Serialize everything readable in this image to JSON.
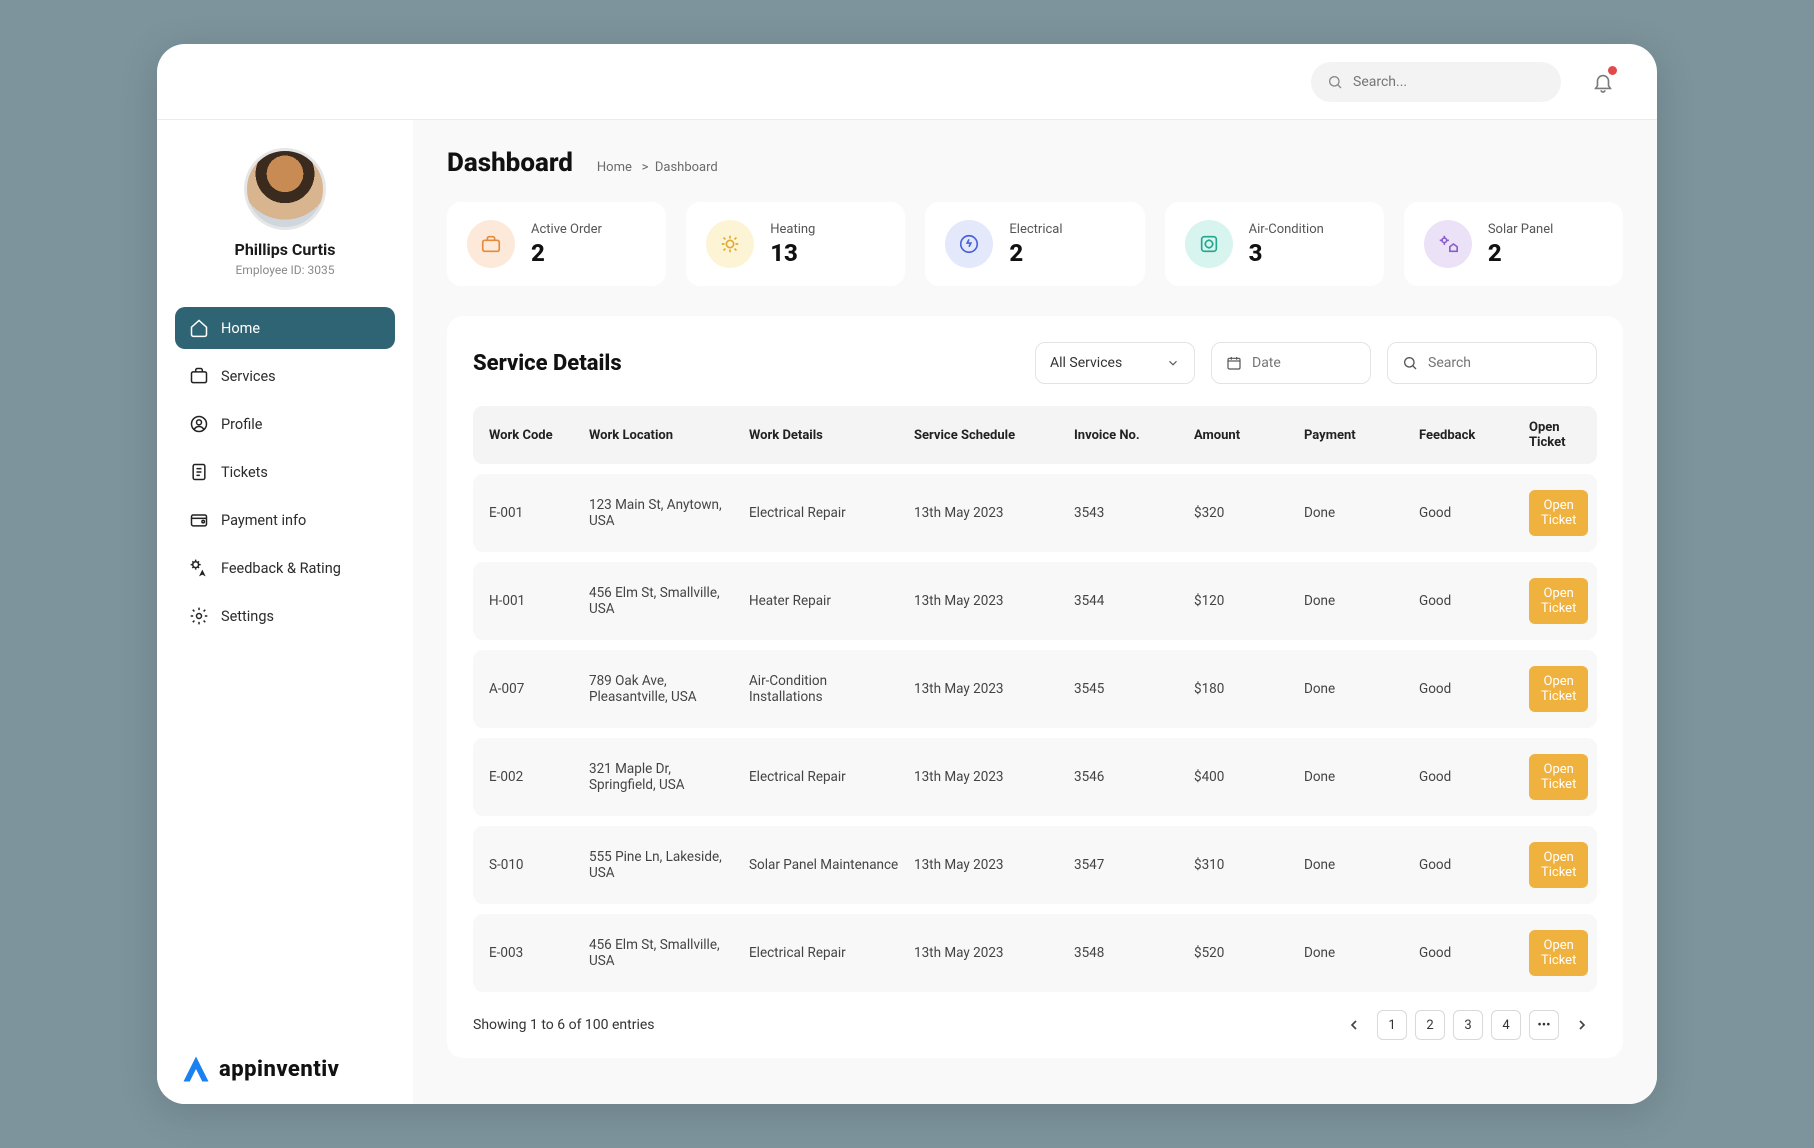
{
  "topbar": {
    "search_placeholder": "Search..."
  },
  "user": {
    "name": "Phillips Curtis",
    "sub": "Employee ID: 3035"
  },
  "nav": {
    "items": [
      {
        "label": "Home"
      },
      {
        "label": "Services"
      },
      {
        "label": "Profile"
      },
      {
        "label": "Tickets"
      },
      {
        "label": "Payment info"
      },
      {
        "label": "Feedback & Rating"
      },
      {
        "label": "Settings"
      }
    ]
  },
  "logo": {
    "text": "appinventiv"
  },
  "page": {
    "title": "Dashboard",
    "crumb_home": "Home",
    "crumb_current": "Dashboard"
  },
  "stats": [
    {
      "label": "Active Order",
      "value": "2",
      "bg": "#fce9d9",
      "stroke": "#e48a3a"
    },
    {
      "label": "Heating",
      "value": "13",
      "bg": "#fdf4d6",
      "stroke": "#e0a92f"
    },
    {
      "label": "Electrical",
      "value": "2",
      "bg": "#e3e8fb",
      "stroke": "#4a61d8"
    },
    {
      "label": "Air-Condition",
      "value": "3",
      "bg": "#d8f4ef",
      "stroke": "#22a68c"
    },
    {
      "label": "Solar Panel",
      "value": "2",
      "bg": "#ece2f8",
      "stroke": "#8a5fc9"
    }
  ],
  "panel": {
    "title": "Service Details",
    "filter_label": "All Services",
    "date_placeholder": "Date",
    "search_placeholder": "Search",
    "columns": {
      "work_code": "Work Code",
      "work_location": "Work Location",
      "work_details": "Work Details",
      "service_schedule": "Service Schedule",
      "invoice_no": "Invoice No.",
      "amount": "Amount",
      "payment": "Payment",
      "feedback": "Feedback",
      "open_ticket": "Open Ticket"
    },
    "rows": [
      {
        "code": "E-001",
        "location": "123 Main St, Anytown, USA",
        "details": "Electrical Repair",
        "schedule": "13th May 2023",
        "invoice": "3543",
        "amount": "$320",
        "payment": "Done",
        "feedback": "Good",
        "action": "Open Ticket"
      },
      {
        "code": "H-001",
        "location": "456 Elm St, Smallville, USA",
        "details": "Heater Repair",
        "schedule": "13th May 2023",
        "invoice": "3544",
        "amount": "$120",
        "payment": "Done",
        "feedback": "Good",
        "action": "Open Ticket"
      },
      {
        "code": "A-007",
        "location": "789 Oak Ave, Pleasantville, USA",
        "details": "Air-Condition Installations",
        "schedule": "13th May 2023",
        "invoice": "3545",
        "amount": "$180",
        "payment": "Done",
        "feedback": "Good",
        "action": "Open Ticket"
      },
      {
        "code": "E-002",
        "location": "321 Maple Dr, Springfield, USA",
        "details": "Electrical Repair",
        "schedule": "13th May 2023",
        "invoice": "3546",
        "amount": "$400",
        "payment": "Done",
        "feedback": "Good",
        "action": "Open Ticket"
      },
      {
        "code": "S-010",
        "location": "555 Pine Ln, Lakeside, USA",
        "details": "Solar Panel Maintenance",
        "schedule": "13th May 2023",
        "invoice": "3547",
        "amount": "$310",
        "payment": "Done",
        "feedback": "Good",
        "action": "Open Ticket"
      },
      {
        "code": "E-003",
        "location": "456 Elm St, Smallville, USA",
        "details": "Electrical Repair",
        "schedule": "13th May 2023",
        "invoice": "3548",
        "amount": "$520",
        "payment": "Done",
        "feedback": "Good",
        "action": "Open Ticket"
      }
    ],
    "footer_text": "Showing 1 to 6 of 100 entries",
    "pages": [
      "1",
      "2",
      "3",
      "4"
    ],
    "more": "•••"
  }
}
